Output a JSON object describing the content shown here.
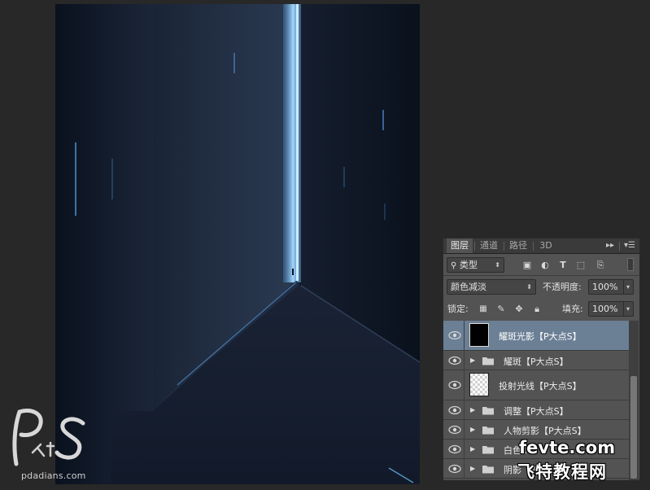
{
  "panel": {
    "tabs": [
      "图层",
      "通道",
      "路径",
      "3D"
    ],
    "tab_icons": [
      "panel-collapse-icon",
      "panel-menu-icon"
    ],
    "filter": {
      "kind_label": "类型",
      "icons": [
        "image-filter-icon",
        "adjustment-filter-icon",
        "type-filter-icon",
        "shape-filter-icon",
        "smart-object-filter-icon"
      ]
    },
    "blend_mode": "颜色减淡",
    "opacity_label": "不透明度:",
    "opacity_value": "100%",
    "lock_label": "锁定:",
    "fill_label": "填充:",
    "fill_value": "100%"
  },
  "layers": [
    {
      "name": "耀斑光影【P大点S】",
      "kind": "layer",
      "thumb": "dark",
      "selected": true
    },
    {
      "name": "耀斑【P大点S】",
      "kind": "group",
      "selected": false
    },
    {
      "name": "投射光线【P大点S】",
      "kind": "layer",
      "thumb": "transparent",
      "selected": false
    },
    {
      "name": "调整【P大点S】",
      "kind": "group",
      "selected": false
    },
    {
      "name": "人物剪影【P大点S】",
      "kind": "group",
      "selected": false
    },
    {
      "name": "白色…",
      "kind": "group",
      "selected": false
    },
    {
      "name": "阴影【P大…",
      "kind": "group",
      "selected": false
    }
  ],
  "watermarks": {
    "logo_url": "pdadians.com",
    "site_line1": "fevte.com",
    "site_line2": "飞特教程网"
  },
  "colors": {
    "panel_bg": "#535353",
    "selected_row": "#6b7f95",
    "canvas_bg": "#0b1322",
    "glow": "#8fd0ff"
  }
}
